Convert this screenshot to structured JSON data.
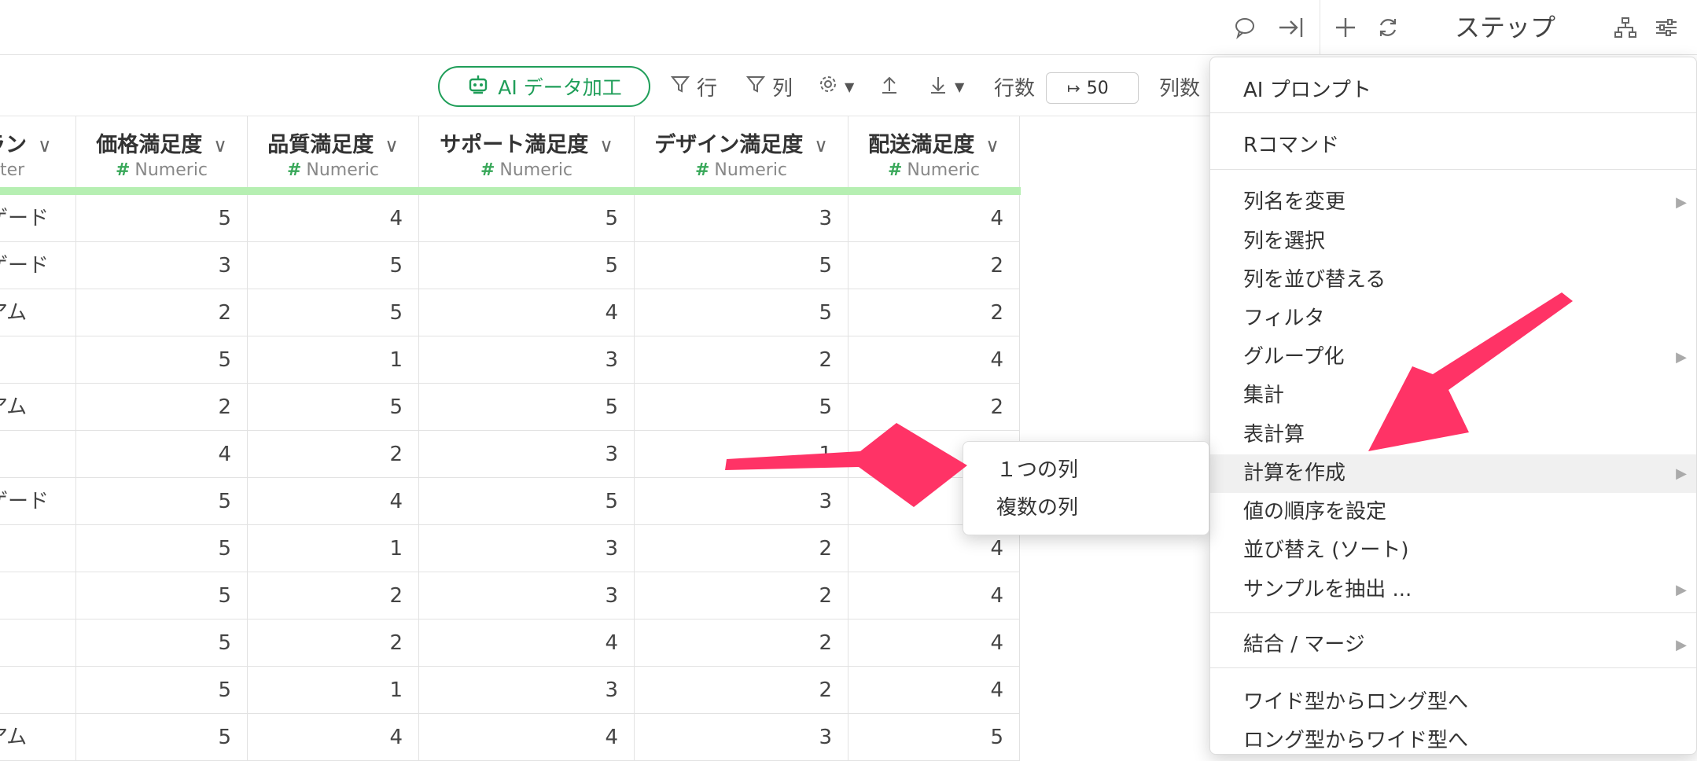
{
  "topbar": {
    "comment_icon": "comment-icon",
    "collapse_icon": "arrow-right-to-line-icon",
    "add_icon": "plus-icon",
    "refresh_icon": "refresh-icon",
    "steps_label": "ステップ",
    "tree_icon": "hierarchy-icon",
    "settings_icon": "sliders-icon"
  },
  "toolbar": {
    "ai_label": "AI データ加工",
    "row_filter_label": "行",
    "col_filter_label": "列",
    "rows_label": "行数",
    "rows_value": "50",
    "cols_label": "列数"
  },
  "columns": [
    {
      "name": "ラン",
      "type": "ter"
    },
    {
      "name": "価格満足度",
      "type": "Numeric"
    },
    {
      "name": "品質満足度",
      "type": "Numeric"
    },
    {
      "name": "サポート満足度",
      "type": "Numeric"
    },
    {
      "name": "デザイン満足度",
      "type": "Numeric"
    },
    {
      "name": "配送満足度",
      "type": "Numeric"
    }
  ],
  "rows": [
    [
      "ゲード",
      "5",
      "4",
      "5",
      "3",
      "4"
    ],
    [
      "ゲード",
      "3",
      "5",
      "5",
      "5",
      "2"
    ],
    [
      "アム",
      "2",
      "5",
      "4",
      "5",
      "2"
    ],
    [
      "",
      "5",
      "1",
      "3",
      "2",
      "4"
    ],
    [
      "アム",
      "2",
      "5",
      "5",
      "5",
      "2"
    ],
    [
      "",
      "4",
      "2",
      "3",
      "1",
      ""
    ],
    [
      "ゲード",
      "5",
      "4",
      "5",
      "3",
      ""
    ],
    [
      "",
      "5",
      "1",
      "3",
      "2",
      "4"
    ],
    [
      "",
      "5",
      "2",
      "3",
      "2",
      "4"
    ],
    [
      "",
      "5",
      "2",
      "4",
      "2",
      "4"
    ],
    [
      "",
      "5",
      "1",
      "3",
      "2",
      "4"
    ],
    [
      "アム",
      "5",
      "4",
      "4",
      "3",
      "5"
    ]
  ],
  "menu": {
    "items": [
      "AI プロンプト",
      "Rコマンド",
      "列名を変更",
      "列を選択",
      "列を並び替える",
      "フィルタ",
      "グループ化",
      "集計",
      "表計算",
      "計算を作成",
      "値の順序を設定",
      "並び替え (ソート)",
      "サンプルを抽出 ...",
      "結合 / マージ",
      "ワイド型からロング型へ",
      "ロング型からワイド型へ"
    ]
  },
  "submenu": {
    "items": [
      "１つの列",
      "複数の列"
    ]
  },
  "colors": {
    "accent": "#1f9e59",
    "header_bar": "#b6efb2",
    "annotation_arrow": "#ff3366"
  }
}
